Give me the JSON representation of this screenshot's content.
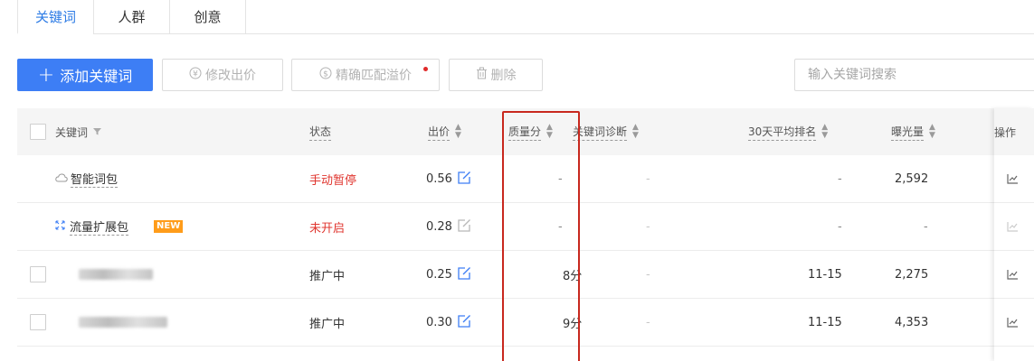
{
  "tabs": [
    {
      "label": "关键词",
      "active": true
    },
    {
      "label": "人群",
      "active": false
    },
    {
      "label": "创意",
      "active": false
    }
  ],
  "toolbar": {
    "add_label": "添加关键词",
    "add_icon": "plus-icon",
    "modify_bid_label": "修改出价",
    "premium_label": "精确匹配溢价",
    "delete_label": "删除"
  },
  "search": {
    "placeholder": "输入关键词搜索"
  },
  "table": {
    "headers": {
      "keyword": "关键词",
      "status": "状态",
      "bid": "出价",
      "quality": "质量分",
      "diagnosis": "关键词诊断",
      "rank": "30天平均排名",
      "exposure": "曝光量",
      "action": "操作"
    },
    "rows": [
      {
        "keyword": "智能词包",
        "icon": "cloud-icon",
        "status": "手动暂停",
        "bid": "0.56",
        "quality": "-",
        "diagnosis": "-",
        "rank": "-",
        "exposure": "2,592"
      },
      {
        "keyword": "流量扩展包",
        "icon": "expand-icon",
        "badge": "NEW",
        "status": "未开启",
        "bid": "0.28",
        "quality": "-",
        "diagnosis": "-",
        "rank": "-",
        "exposure": "-"
      },
      {
        "keyword": "",
        "status": "推广中",
        "bid": "0.25",
        "quality": "8分",
        "diagnosis": "-",
        "rank": "11-15",
        "exposure": "2,275"
      },
      {
        "keyword": "",
        "status": "推广中",
        "bid": "0.30",
        "quality": "9分",
        "diagnosis": "-",
        "rank": "11-15",
        "exposure": "4,353"
      }
    ]
  },
  "colors": {
    "accent": "#3d7ef5",
    "status_red": "#e0362f",
    "highlight": "#c8281e",
    "badge": "#ff9c1a"
  }
}
